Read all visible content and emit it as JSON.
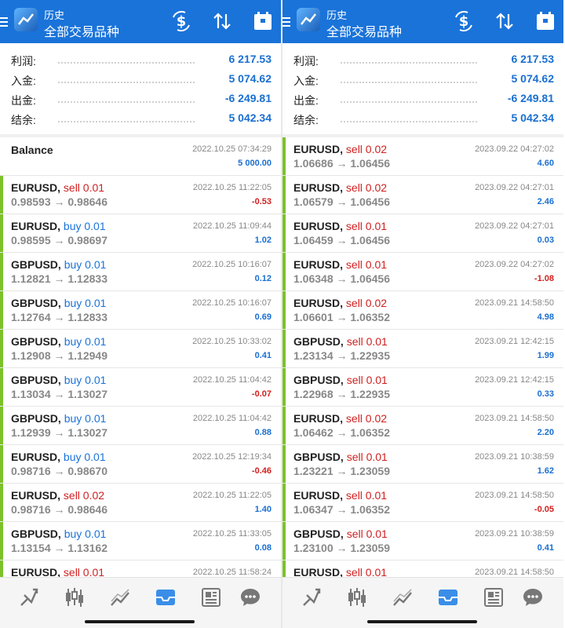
{
  "colors": {
    "header": "#1a73d9",
    "buy": "#1a73d9",
    "sell": "#d01f1f",
    "profit_positive": "#1a6fd0",
    "profit_negative": "#d01f1f",
    "bar": "#7cc22a"
  },
  "header": {
    "title_small": "历史",
    "title_big": "全部交易品种"
  },
  "toolbar_icons": [
    "dollar-refresh-icon",
    "sort-icon",
    "calendar-icon"
  ],
  "nav_icons": [
    "trade-icon",
    "candlestick-icon",
    "chart-icon",
    "history-icon",
    "news-icon",
    "chat-icon"
  ],
  "left": {
    "summary": [
      {
        "label": "利润:",
        "value": "6 217.53"
      },
      {
        "label": "入金:",
        "value": "5 074.62"
      },
      {
        "label": "出金:",
        "value": "-6 249.81"
      },
      {
        "label": "结余:",
        "value": "5 042.34"
      }
    ],
    "balance": {
      "label": "Balance",
      "time": "2022.10.25 07:34:29",
      "amount": "5 000.00"
    },
    "trades": [
      {
        "symbol": "EURUSD,",
        "side": "sell 0.01",
        "type": "sell",
        "prices": "0.98593 → 0.98646",
        "time": "2022.10.25 11:22:05",
        "profit": "-0.53"
      },
      {
        "symbol": "EURUSD,",
        "side": "buy 0.01",
        "type": "buy",
        "prices": "0.98595 → 0.98697",
        "time": "2022.10.25 11:09:44",
        "profit": "1.02"
      },
      {
        "symbol": "GBPUSD,",
        "side": "buy 0.01",
        "type": "buy",
        "prices": "1.12821 → 1.12833",
        "time": "2022.10.25 10:16:07",
        "profit": "0.12"
      },
      {
        "symbol": "GBPUSD,",
        "side": "buy 0.01",
        "type": "buy",
        "prices": "1.12764 → 1.12833",
        "time": "2022.10.25 10:16:07",
        "profit": "0.69"
      },
      {
        "symbol": "GBPUSD,",
        "side": "buy 0.01",
        "type": "buy",
        "prices": "1.12908 → 1.12949",
        "time": "2022.10.25 10:33:02",
        "profit": "0.41"
      },
      {
        "symbol": "GBPUSD,",
        "side": "buy 0.01",
        "type": "buy",
        "prices": "1.13034 → 1.13027",
        "time": "2022.10.25 11:04:42",
        "profit": "-0.07"
      },
      {
        "symbol": "GBPUSD,",
        "side": "buy 0.01",
        "type": "buy",
        "prices": "1.12939 → 1.13027",
        "time": "2022.10.25 11:04:42",
        "profit": "0.88"
      },
      {
        "symbol": "EURUSD,",
        "side": "buy 0.01",
        "type": "buy",
        "prices": "0.98716 → 0.98670",
        "time": "2022.10.25 12:19:34",
        "profit": "-0.46"
      },
      {
        "symbol": "EURUSD,",
        "side": "sell 0.02",
        "type": "sell",
        "prices": "0.98716 → 0.98646",
        "time": "2022.10.25 11:22:05",
        "profit": "1.40"
      },
      {
        "symbol": "GBPUSD,",
        "side": "buy 0.01",
        "type": "buy",
        "prices": "1.13154 → 1.13162",
        "time": "2022.10.25 11:33:05",
        "profit": "0.08"
      },
      {
        "symbol": "EURUSD,",
        "side": "sell 0.01",
        "type": "sell",
        "prices": "",
        "time": "2022.10.25 11:58:24",
        "profit": ""
      }
    ]
  },
  "right": {
    "summary": [
      {
        "label": "利润:",
        "value": "6 217.53"
      },
      {
        "label": "入金:",
        "value": "5 074.62"
      },
      {
        "label": "出金:",
        "value": "-6 249.81"
      },
      {
        "label": "结余:",
        "value": "5 042.34"
      }
    ],
    "trades": [
      {
        "symbol": "EURUSD,",
        "side": "sell 0.02",
        "type": "sell",
        "prices": "1.06686 → 1.06456",
        "time": "2023.09.22 04:27:02",
        "profit": "4.60"
      },
      {
        "symbol": "EURUSD,",
        "side": "sell 0.02",
        "type": "sell",
        "prices": "1.06579 → 1.06456",
        "time": "2023.09.22 04:27:01",
        "profit": "2.46"
      },
      {
        "symbol": "EURUSD,",
        "side": "sell 0.01",
        "type": "sell",
        "prices": "1.06459 → 1.06456",
        "time": "2023.09.22 04:27:01",
        "profit": "0.03"
      },
      {
        "symbol": "EURUSD,",
        "side": "sell 0.01",
        "type": "sell",
        "prices": "1.06348 → 1.06456",
        "time": "2023.09.22 04:27:02",
        "profit": "-1.08"
      },
      {
        "symbol": "EURUSD,",
        "side": "sell 0.02",
        "type": "sell",
        "prices": "1.06601 → 1.06352",
        "time": "2023.09.21 14:58:50",
        "profit": "4.98"
      },
      {
        "symbol": "GBPUSD,",
        "side": "sell 0.01",
        "type": "sell",
        "prices": "1.23134 → 1.22935",
        "time": "2023.09.21 12:42:15",
        "profit": "1.99"
      },
      {
        "symbol": "GBPUSD,",
        "side": "sell 0.01",
        "type": "sell",
        "prices": "1.22968 → 1.22935",
        "time": "2023.09.21 12:42:15",
        "profit": "0.33"
      },
      {
        "symbol": "EURUSD,",
        "side": "sell 0.02",
        "type": "sell",
        "prices": "1.06462 → 1.06352",
        "time": "2023.09.21 14:58:50",
        "profit": "2.20"
      },
      {
        "symbol": "GBPUSD,",
        "side": "sell 0.01",
        "type": "sell",
        "prices": "1.23221 → 1.23059",
        "time": "2023.09.21 10:38:59",
        "profit": "1.62"
      },
      {
        "symbol": "EURUSD,",
        "side": "sell 0.01",
        "type": "sell",
        "prices": "1.06347 → 1.06352",
        "time": "2023.09.21 14:58:50",
        "profit": "-0.05"
      },
      {
        "symbol": "GBPUSD,",
        "side": "sell 0.01",
        "type": "sell",
        "prices": "1.23100 → 1.23059",
        "time": "2023.09.21 10:38:59",
        "profit": "0.41"
      },
      {
        "symbol": "EURUSD,",
        "side": "sell 0.01",
        "type": "sell",
        "prices": "",
        "time": "2023.09.21 14:58:50",
        "profit": ""
      }
    ]
  }
}
